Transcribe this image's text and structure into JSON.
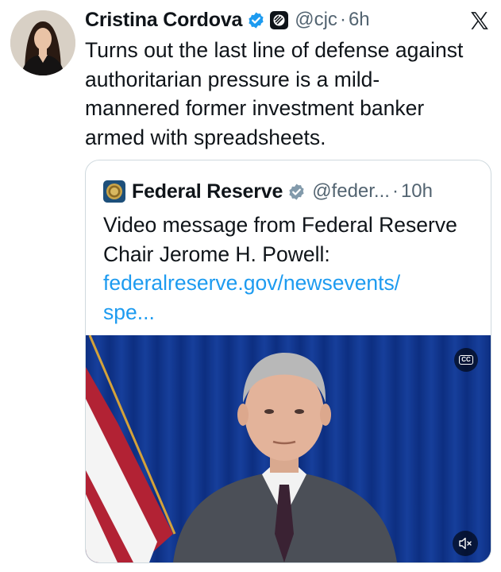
{
  "tweet": {
    "display_name": "Cristina Cordova",
    "handle": "@cjc",
    "separator": "·",
    "time": "6h",
    "text": "Turns out the last line of defense against\nauthoritarian pressure is a mild-\nmannered former investment banker\narmed with spreadsheets.",
    "verified_badge_color": "#1d9bf0",
    "icons": [
      "verified-badge-icon",
      "affiliate-badge-icon",
      "x-logo-icon"
    ]
  },
  "quote": {
    "display_name": "Federal Reserve",
    "handle": "@feder...",
    "separator": "·",
    "time": "10h",
    "text": "Video message from Federal Reserve Chair Jerome H. Powell: ",
    "link_text": "federalreserve.gov/newsevents/\nspe...",
    "link_color": "#1d9bf0",
    "badge_color": "#829aab",
    "video": {
      "cc_label": "CC",
      "icons": [
        "closed-captions-icon",
        "mute-icon"
      ]
    }
  }
}
